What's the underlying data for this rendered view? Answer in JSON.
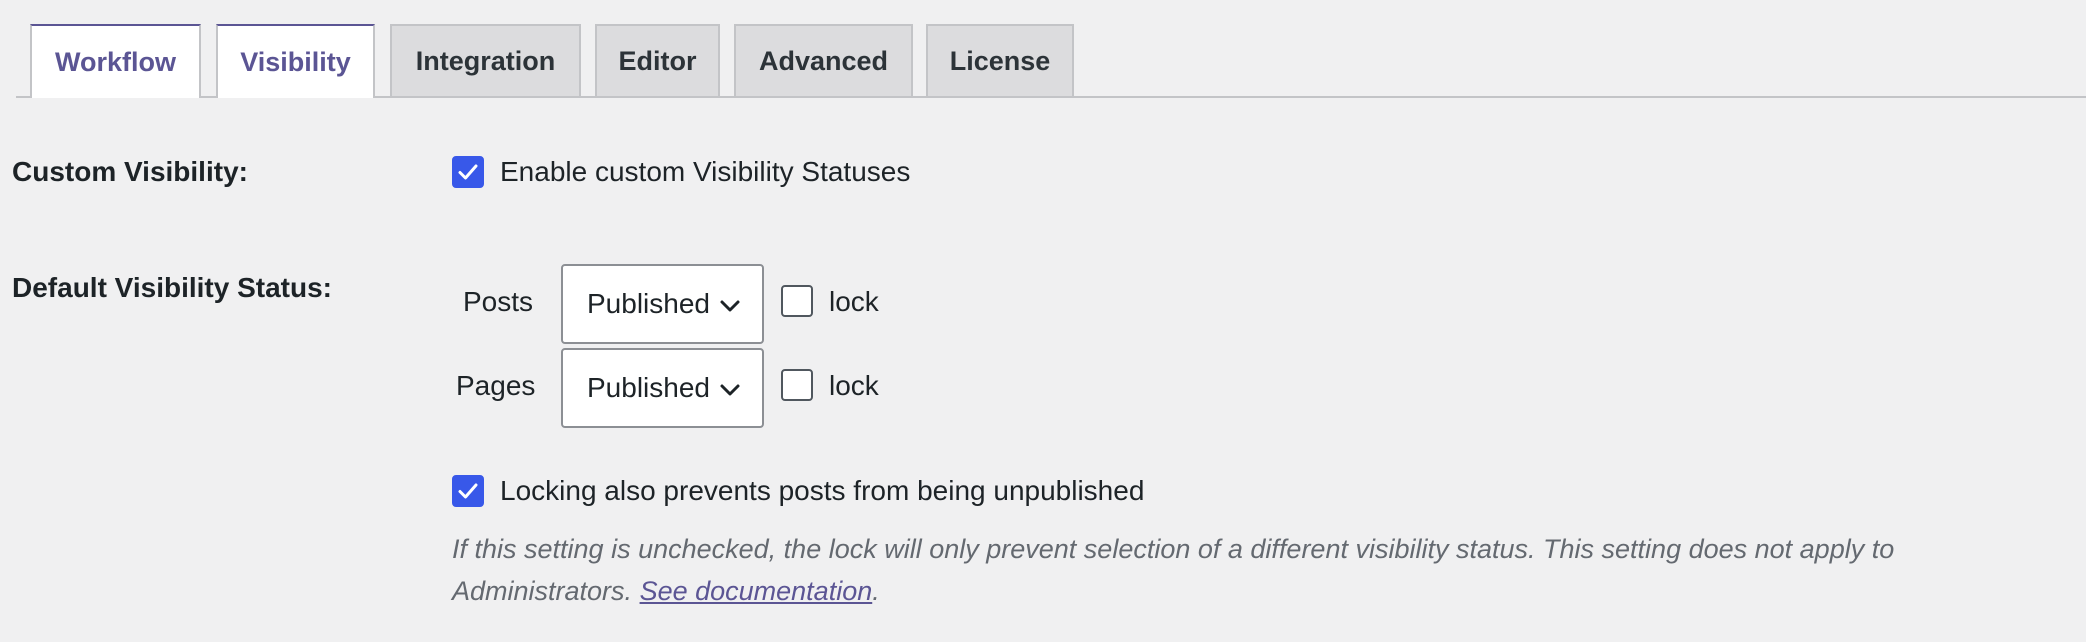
{
  "tabs": [
    {
      "label": "Workflow",
      "active": true
    },
    {
      "label": "Visibility",
      "active": true
    },
    {
      "label": "Integration",
      "active": false
    },
    {
      "label": "Editor",
      "active": false
    },
    {
      "label": "Advanced",
      "active": false
    },
    {
      "label": "License",
      "active": false
    }
  ],
  "custom_visibility": {
    "label": "Custom Visibility:",
    "checkbox_label": "Enable custom Visibility Statuses",
    "checked": true
  },
  "default_status": {
    "label": "Default Visibility Status:",
    "rows": [
      {
        "type_label": "Posts",
        "selected": "Published",
        "lock_label": "lock",
        "locked": false
      },
      {
        "type_label": "Pages",
        "selected": "Published",
        "lock_label": "lock",
        "locked": false
      }
    ],
    "prevent_unpublish_label": "Locking also prevents posts from being unpublished",
    "prevent_unpublish_checked": true,
    "description": "If this setting is unchecked, the lock will only prevent selection of a different visibility status. This setting does not apply to Administrators. ",
    "doc_link": "See documentation",
    "doc_suffix": "."
  },
  "colors": {
    "accent": "#5b5594",
    "checkbox": "#3858e9",
    "background": "#f0f0f1"
  }
}
